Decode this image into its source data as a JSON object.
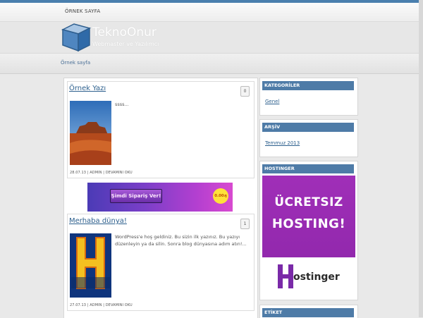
{
  "topnav": {
    "item": "ÖRNEK SAYFA"
  },
  "header": {
    "title": "TeknoOnur",
    "tagline": "Webmaster ve Yazılımcı"
  },
  "subnav": {
    "item": "Örnek sayfa"
  },
  "posts": [
    {
      "title": "Örnek Yazı",
      "comments": "0",
      "excerpt": "ssss...",
      "date": "28.07.13",
      "author": "ADMIN",
      "more": "DEVAMINI OKU"
    },
    {
      "title": "Merhaba dünya!",
      "comments": "1",
      "excerpt": "WordPress'e hoş geldiniz. Bu sizin ilk yazınız. Bu yazıyı düzenleyin ya da silin. Sonra blog dünyasına adım atın!...",
      "date": "27.07.13",
      "author": "ADMIN",
      "more": "DEVAMINI OKU"
    }
  ],
  "banner": {
    "button": "Şimdi Sipariş Ver!",
    "price": "0.00ԓ"
  },
  "sidebar": {
    "categories": {
      "title": "KATEGORİLER",
      "link": "Genel"
    },
    "archive": {
      "title": "ARŞİV",
      "link": "Temmuz 2013"
    },
    "hosting": {
      "title": "HOSTINGER",
      "line1": "ÜCRETSIZ",
      "line2": "HOSTING!",
      "brand": "ostinger"
    },
    "tags": {
      "title": "ETİKET"
    }
  },
  "colors": {
    "accent": "#4e7ba7",
    "link": "#2c5f8d",
    "ad_purple": "#9a2cb2"
  }
}
